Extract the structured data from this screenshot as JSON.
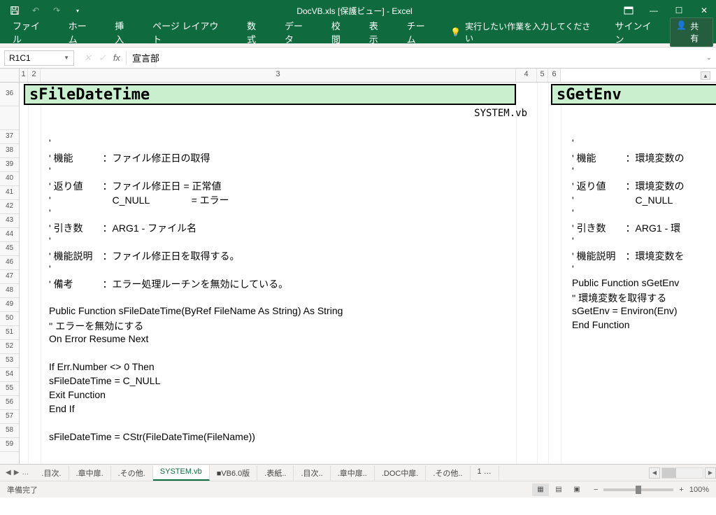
{
  "titlebar": {
    "title": "DocVB.xls [保護ビュー] - Excel"
  },
  "ribbon": {
    "tabs": [
      "ファイル",
      "ホーム",
      "挿入",
      "ページ レイアウト",
      "数式",
      "データ",
      "校閲",
      "表示",
      "チーム"
    ],
    "tellme": "実行したい作業を入力してください",
    "signin": "サインイン",
    "share": "共有"
  },
  "formulabar": {
    "namebox": "R1C1",
    "value": "宣言部"
  },
  "columns": {
    "c1": "1",
    "c2": "2",
    "c3": "3",
    "c4": "4",
    "c5": "5",
    "c6": "6"
  },
  "rows": [
    "36",
    "",
    "37",
    "38",
    "39",
    "40",
    "41",
    "42",
    "43",
    "44",
    "45",
    "46",
    "47",
    "48",
    "49",
    "50",
    "51",
    "52",
    "53",
    "54",
    "55",
    "56",
    "57",
    "58",
    "59"
  ],
  "titles": {
    "left": "sFileDateTime",
    "right": "sGetEnv",
    "file": "SYSTEM.vb"
  },
  "code_left": [
    "",
    "'",
    "' 機能　　　：ファイル修正日の取得",
    "'",
    "' 返り値　　：ファイル修正日 = 正常値",
    "'　　　　　　 C_NULL　　　　 = エラー",
    "'",
    "' 引き数　　：ARG1 - ファイル名",
    "'",
    "' 機能説明　：ファイル修正日を取得する。",
    "'",
    "' 備考　　　：エラー処理ルーチンを無効にしている。",
    "",
    "Public Function sFileDateTime(ByRef FileName As String) As String",
    " '' エラーを無効にする",
    " On Error Resume Next",
    "",
    "  If Err.Number <> 0 Then",
    "    sFileDateTime = C_NULL",
    "    Exit Function",
    "  End If",
    "",
    "  sFileDateTime = CStr(FileDateTime(FileName))"
  ],
  "code_right": [
    "",
    "'",
    "' 機能　　　：環境変数の",
    "'",
    "' 返り値　　：環境変数の",
    "'　　　　　　 C_NULL",
    "'",
    "' 引き数　　：ARG1 - 環",
    "'",
    "' 機能説明　：環境変数を",
    "'",
    "Public Function sGetEnv",
    " '' 環境変数を取得する",
    "  sGetEnv = Environ(Env)",
    "End Function"
  ],
  "sheettabs": {
    "nav_dots": "…",
    "tabs": [
      ".目次.",
      ".章中扉.",
      ".その他.",
      "SYSTEM.vb",
      "■VB6.0版",
      ".表紙..",
      ".目次..",
      ".章中扉..",
      ".DOC中扉.",
      ".その他..",
      "1 …"
    ],
    "active_index": 3
  },
  "statusbar": {
    "ready": "準備完了",
    "zoom": "100%"
  }
}
